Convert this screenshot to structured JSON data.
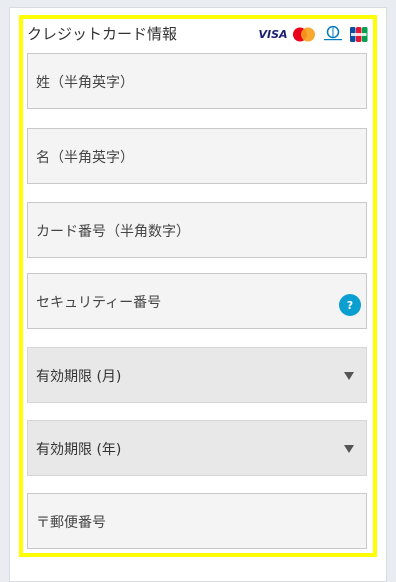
{
  "form": {
    "title": "クレジットカード情報",
    "card_brands": [
      "VISA",
      "MasterCard",
      "Diners Club",
      "JCB"
    ],
    "visa_text": "VISA",
    "fields": {
      "last_name": "姓（半角英字）",
      "first_name": "名（半角英字）",
      "card_number": "カード番号（半角数字）",
      "security_code": "セキュリティー番号",
      "expiry_month": "有効期限 (月)",
      "expiry_year": "有効期限 (年)",
      "postal_code": "〒郵便番号"
    },
    "help_icon_text": "?"
  },
  "colors": {
    "highlight": "#ffff00",
    "help_icon": "#0a9fd0",
    "mastercard_red": "#eb001b",
    "mastercard_orange": "#f79e1b",
    "diners_blue": "#0079be"
  }
}
